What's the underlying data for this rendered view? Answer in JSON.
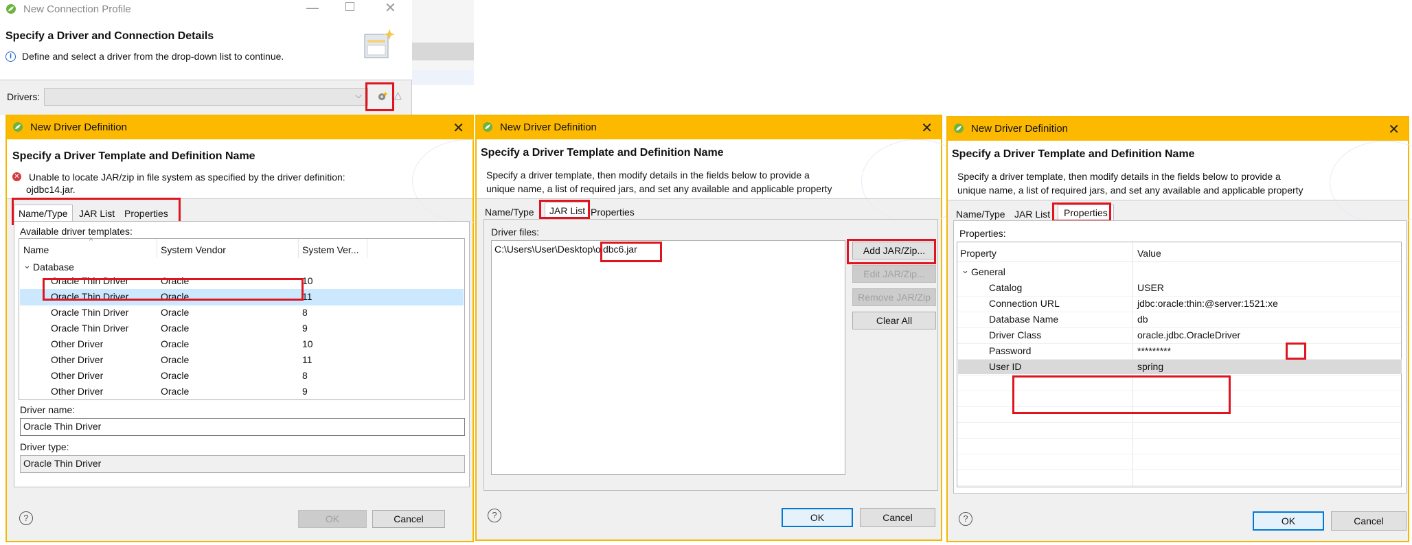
{
  "background_window": {
    "title": "New Connection Profile",
    "banner_title": "Specify a Driver and Connection Details",
    "banner_message": "Define and select a driver from the drop-down list to continue.",
    "drivers_label": "Drivers:",
    "drivers_value": ""
  },
  "dialog1": {
    "title": "New Driver Definition",
    "banner_title": "Specify a Driver Template and Definition Name",
    "error_message": "Unable to locate JAR/zip in file system as specified by the driver definition:",
    "error_message_line2": "ojdbc14.jar.",
    "tabs": [
      "Name/Type",
      "JAR List",
      "Properties"
    ],
    "templates_label": "Available driver templates:",
    "columns": [
      "Name",
      "System Vendor",
      "System Ver..."
    ],
    "category": "Database",
    "rows": [
      {
        "name": "Oracle Thin Driver",
        "vendor": "Oracle",
        "version": "10"
      },
      {
        "name": "Oracle Thin Driver",
        "vendor": "Oracle",
        "version": "11"
      },
      {
        "name": "Oracle Thin Driver",
        "vendor": "Oracle",
        "version": "8"
      },
      {
        "name": "Oracle Thin Driver",
        "vendor": "Oracle",
        "version": "9"
      },
      {
        "name": "Other Driver",
        "vendor": "Oracle",
        "version": "10"
      },
      {
        "name": "Other Driver",
        "vendor": "Oracle",
        "version": "11"
      },
      {
        "name": "Other Driver",
        "vendor": "Oracle",
        "version": "8"
      },
      {
        "name": "Other Driver",
        "vendor": "Oracle",
        "version": "9"
      }
    ],
    "driver_name_label": "Driver name:",
    "driver_name_value": "Oracle Thin Driver",
    "driver_type_label": "Driver type:",
    "driver_type_value": "Oracle Thin Driver",
    "ok_label": "OK",
    "cancel_label": "Cancel"
  },
  "dialog2": {
    "title": "New Driver Definition",
    "banner_title": "Specify a Driver Template and Definition Name",
    "message_line1": "Specify a driver template, then modify details in the fields below to provide a",
    "message_line2": "unique name, a list of required jars, and set any available and applicable property",
    "tabs": [
      "Name/Type",
      "JAR List",
      "Properties"
    ],
    "driver_files_label": "Driver files:",
    "file_path_prefix": "C:\\Users\\User\\Desktop\\",
    "file_name": "ojdbc6.jar",
    "add_button": "Add JAR/Zip...",
    "edit_button": "Edit JAR/Zip...",
    "remove_button": "Remove JAR/Zip",
    "clear_button": "Clear All",
    "ok_label": "OK",
    "cancel_label": "Cancel"
  },
  "dialog3": {
    "title": "New Driver Definition",
    "banner_title": "Specify a Driver Template and Definition Name",
    "message_line1": "Specify a driver template, then modify details in the fields below to provide a",
    "message_line2": "unique name, a list of required jars, and set any available and applicable property",
    "tabs": [
      "Name/Type",
      "JAR List",
      "Properties"
    ],
    "properties_label": "Properties:",
    "columns": [
      "Property",
      "Value"
    ],
    "group": "General",
    "rows": [
      {
        "property": "Catalog",
        "value": "USER"
      },
      {
        "property": "Connection URL",
        "value": "jdbc:oracle:thin:@server:1521:xe"
      },
      {
        "property": "Database Name",
        "value": "db"
      },
      {
        "property": "Driver Class",
        "value": "oracle.jdbc.OracleDriver"
      },
      {
        "property": "Password",
        "value": "*********"
      },
      {
        "property": "User ID",
        "value": "spring"
      }
    ],
    "ok_label": "OK",
    "cancel_label": "Cancel"
  }
}
